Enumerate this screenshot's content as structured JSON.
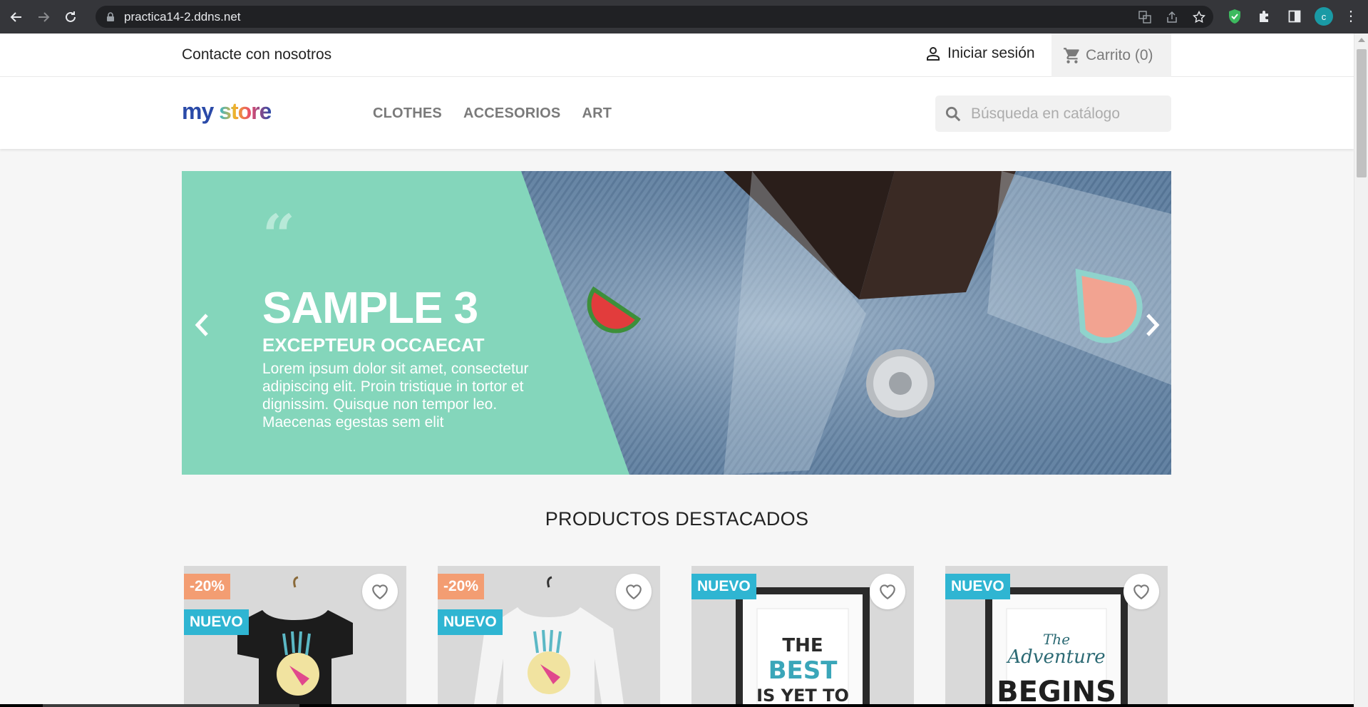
{
  "browser": {
    "url": "practica14-2.ddns.net",
    "avatar_letter": "c"
  },
  "topbar": {
    "contact_label": "Contacte con nosotros",
    "login_label": "Iniciar sesión",
    "cart_label": "Carrito (0)"
  },
  "header": {
    "logo": {
      "my": "my",
      "store": "store"
    },
    "menu": [
      {
        "label": "CLOTHES"
      },
      {
        "label": "ACCESORIOS"
      },
      {
        "label": "ART"
      }
    ],
    "search_placeholder": "Búsqueda en catálogo"
  },
  "slider": {
    "title": "SAMPLE 3",
    "subtitle": "EXCEPTEUR OCCAECAT",
    "text": "Lorem ipsum dolor sit amet, consectetur adipiscing elit. Proin tristique in tortor et dignissim. Quisque non tempor leo. Maecenas egestas sem elit",
    "panel_color": "#84d6bb"
  },
  "featured": {
    "title": "PRODUCTOS DESTACADOS",
    "products": [
      {
        "discount": "-20%",
        "flag": "NUEVO",
        "image": "black-tshirt-hummingbird"
      },
      {
        "discount": "-20%",
        "flag": "NUEVO",
        "image": "white-sweater-hummingbird"
      },
      {
        "flag": "NUEVO",
        "image": "poster-the-best-is-yet-to-come"
      },
      {
        "flag": "NUEVO",
        "image": "poster-the-adventure-begins"
      }
    ]
  },
  "colors": {
    "discount_badge": "#f39d72",
    "new_badge": "#2fb5d2"
  }
}
